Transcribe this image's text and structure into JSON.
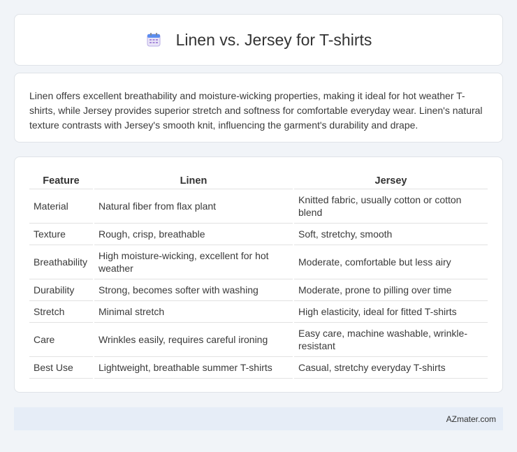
{
  "header": {
    "title": "Linen vs. Jersey for T-shirts",
    "icon": "calendar-icon"
  },
  "summary": {
    "text": "Linen offers excellent breathability and moisture-wicking properties, making it ideal for hot weather T-shirts, while Jersey provides superior stretch and softness for comfortable everyday wear. Linen's natural texture contrasts with Jersey's smooth knit, influencing the garment's durability and drape."
  },
  "table": {
    "headers": [
      "Feature",
      "Linen",
      "Jersey"
    ],
    "rows": [
      [
        "Material",
        "Natural fiber from flax plant",
        "Knitted fabric, usually cotton or cotton blend"
      ],
      [
        "Texture",
        "Rough, crisp, breathable",
        "Soft, stretchy, smooth"
      ],
      [
        "Breathability",
        "High moisture-wicking, excellent for hot weather",
        "Moderate, comfortable but less airy"
      ],
      [
        "Durability",
        "Strong, becomes softer with washing",
        "Moderate, prone to pilling over time"
      ],
      [
        "Stretch",
        "Minimal stretch",
        "High elasticity, ideal for fitted T-shirts"
      ],
      [
        "Care",
        "Wrinkles easily, requires careful ironing",
        "Easy care, machine washable, wrinkle-resistant"
      ],
      [
        "Best Use",
        "Lightweight, breathable summer T-shirts",
        "Casual, stretchy everyday T-shirts"
      ]
    ]
  },
  "footer": {
    "site": "AZmater.com"
  }
}
